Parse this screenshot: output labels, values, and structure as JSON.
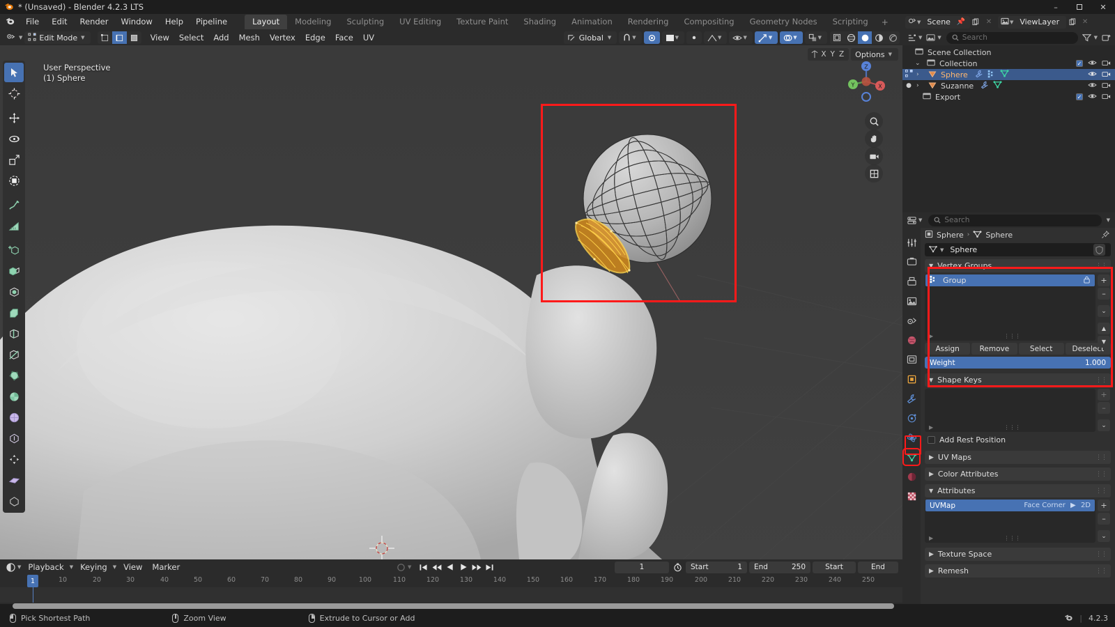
{
  "titlebar": {
    "title": "* (Unsaved) - Blender 4.2.3 LTS",
    "logo_icon": "blender-logo-icon",
    "minimize_label": "–",
    "maximize_label": "❐",
    "close_label": "✕"
  },
  "menubar": {
    "app_icon": "blender-menu-icon",
    "items": [
      "File",
      "Edit",
      "Render",
      "Window",
      "Help",
      "Pipeline"
    ],
    "workspaces": [
      {
        "label": "Layout",
        "active": true
      },
      {
        "label": "Modeling",
        "active": false
      },
      {
        "label": "Sculpting",
        "active": false
      },
      {
        "label": "UV Editing",
        "active": false
      },
      {
        "label": "Texture Paint",
        "active": false
      },
      {
        "label": "Shading",
        "active": false
      },
      {
        "label": "Animation",
        "active": false
      },
      {
        "label": "Rendering",
        "active": false
      },
      {
        "label": "Compositing",
        "active": false
      },
      {
        "label": "Geometry Nodes",
        "active": false
      },
      {
        "label": "Scripting",
        "active": false
      }
    ],
    "add_workspace_label": "+"
  },
  "viewport_header": {
    "editor_type_icon": "editor-type-icon",
    "mode": "Edit Mode",
    "select_modes": [
      {
        "name": "vertex-select-mode",
        "active": false
      },
      {
        "name": "edge-select-mode",
        "active": true
      },
      {
        "name": "face-select-mode",
        "active": false
      }
    ],
    "menus": [
      "View",
      "Select",
      "Add",
      "Mesh",
      "Vertex",
      "Edge",
      "Face",
      "UV"
    ],
    "transform_orientation": "Global",
    "snap_icon": "magnet-icon",
    "proportional_icon": "proportional-editing-icon",
    "visibility_icon": "visibility-icon",
    "gizmo_icon": "gizmo-icon",
    "overlays_icon": "overlays-icon",
    "xray_icon": "xray-icon",
    "shading_modes": [
      "wireframe",
      "solid",
      "material-preview",
      "rendered"
    ],
    "active_shading": "solid"
  },
  "viewport": {
    "perspective_label": "User Perspective",
    "object_label": "(1) Sphere",
    "options_label": "Options",
    "axis_labels": [
      "X",
      "Y",
      "Z"
    ],
    "gizmo_axes": [
      "X",
      "Y",
      "Z"
    ],
    "tools": [
      {
        "name": "tweak-tool",
        "active": true
      },
      {
        "name": "select-box-tool",
        "active": false
      },
      {
        "name": "cursor-tool",
        "active": false
      },
      {
        "name": "move-tool",
        "active": false
      },
      {
        "name": "rotate-tool",
        "active": false
      },
      {
        "name": "scale-tool",
        "active": false
      },
      {
        "name": "transform-tool",
        "active": false
      },
      {
        "name": "annotate-tool",
        "active": false
      },
      {
        "name": "measure-tool",
        "active": false
      },
      {
        "name": "add-cube-tool",
        "active": false
      },
      {
        "name": "extrude-region-tool",
        "active": false
      },
      {
        "name": "inset-faces-tool",
        "active": false
      },
      {
        "name": "bevel-tool",
        "active": false
      },
      {
        "name": "loop-cut-tool",
        "active": false
      },
      {
        "name": "knife-tool",
        "active": false
      },
      {
        "name": "poly-build-tool",
        "active": false
      },
      {
        "name": "spin-tool",
        "active": false
      },
      {
        "name": "smooth-tool",
        "active": false
      },
      {
        "name": "shrink-fatten-tool",
        "active": false
      },
      {
        "name": "shear-tool",
        "active": false
      },
      {
        "name": "rip-region-tool",
        "active": false
      }
    ],
    "nav_buttons": [
      "zoom-icon",
      "pan-icon",
      "camera-icon",
      "ortho-toggle-icon"
    ]
  },
  "scene_bar": {
    "scene_icon": "scene-icon",
    "scene_name": "Scene",
    "view_layer_icon": "viewlayer-icon",
    "view_layer_name": "ViewLayer",
    "pin_icon": "pin-icon",
    "copy_icon": "new-scene-icon",
    "close_icon": "remove-icon"
  },
  "outliner": {
    "display_mode_icon": "outliner-display-icon",
    "filter_icon": "filter-icon",
    "new_collection_icon": "new-collection-icon",
    "search_placeholder": "Search",
    "search_icon": "search-icon",
    "rows": [
      {
        "label": "Scene Collection",
        "icon": "collection-icon",
        "depth": 0,
        "selected": false,
        "expand": "",
        "checkbox": false,
        "eye": false,
        "camera": false
      },
      {
        "label": "Collection",
        "icon": "collection-icon",
        "depth": 1,
        "selected": false,
        "expand": "⌄",
        "checkbox": true,
        "eye": true,
        "camera": true
      },
      {
        "label": "Sphere",
        "icon": "mesh-object-icon",
        "depth": 2,
        "selected": true,
        "expand": "›",
        "checkbox": false,
        "eye": true,
        "camera": true,
        "extra_icons": [
          "modifier-icon",
          "vertex-group-icon",
          "mesh-data-icon"
        ]
      },
      {
        "label": "Suzanne",
        "icon": "mesh-object-icon",
        "depth": 2,
        "selected": false,
        "expand": "›",
        "checkbox": false,
        "eye": true,
        "camera": true,
        "extra_icons": [
          "modifier-icon",
          "mesh-data-icon"
        ]
      },
      {
        "label": "Export",
        "icon": "collection-icon",
        "depth": 1,
        "selected": false,
        "expand": "",
        "checkbox": true,
        "eye": true,
        "camera": true
      }
    ]
  },
  "properties": {
    "editor_icon": "properties-editor-icon",
    "search_placeholder": "Search",
    "search_icon": "search-icon",
    "breadcrumb": {
      "object_icon": "object-icon",
      "object_name": "Sphere",
      "separator": "›",
      "data_icon": "mesh-data-icon",
      "data_name": "Sphere"
    },
    "pin_icon": "pin-icon",
    "datablock": {
      "icon": "mesh-data-icon",
      "name": "Sphere",
      "shield_icon": "fake-user-icon"
    },
    "tabs": [
      {
        "name": "tool-tab",
        "icon": "tool-icon",
        "active": false
      },
      {
        "name": "render-tab",
        "icon": "render-icon",
        "active": false
      },
      {
        "name": "output-tab",
        "icon": "output-icon",
        "active": false
      },
      {
        "name": "view-layer-tab",
        "icon": "view-layer-icon",
        "active": false
      },
      {
        "name": "scene-tab",
        "icon": "scene-props-icon",
        "active": false
      },
      {
        "name": "world-tab",
        "icon": "world-icon",
        "active": false
      },
      {
        "name": "collection-tab",
        "icon": "collection-props-icon",
        "active": false
      },
      {
        "name": "object-tab",
        "icon": "object-props-icon",
        "active": false
      },
      {
        "name": "modifier-tab",
        "icon": "wrench-icon",
        "active": false
      },
      {
        "name": "particles-tab",
        "icon": "particles-icon",
        "active": false
      },
      {
        "name": "physics-tab",
        "icon": "physics-icon",
        "active": false
      },
      {
        "name": "constraints-tab",
        "icon": "constraints-icon",
        "active": false
      },
      {
        "name": "data-tab",
        "icon": "mesh-data-icon",
        "active": true
      },
      {
        "name": "material-tab",
        "icon": "material-icon",
        "active": false
      },
      {
        "name": "texture-tab",
        "icon": "texture-icon",
        "active": false
      }
    ],
    "panels": {
      "vertex_groups": {
        "title": "Vertex Groups",
        "expanded": true,
        "items": [
          {
            "label": "Group",
            "selected": true,
            "icon": "vertex-group-icon",
            "lock_icon": "lock-icon"
          }
        ],
        "side_buttons": [
          "+",
          "–",
          "⌄",
          "▲",
          "▼"
        ],
        "buttons": [
          "Assign",
          "Remove",
          "Select",
          "Deselect"
        ],
        "weight_label": "Weight",
        "weight_value": "1.000"
      },
      "shape_keys": {
        "title": "Shape Keys",
        "expanded": true,
        "items": [],
        "side_buttons": [
          "+",
          "–",
          "⌄"
        ],
        "add_rest_position_label": "Add Rest Position",
        "add_rest_position_checked": false
      },
      "uv_maps": {
        "title": "UV Maps",
        "expanded": false
      },
      "color_attributes": {
        "title": "Color Attributes",
        "expanded": false
      },
      "attributes": {
        "title": "Attributes",
        "expanded": true,
        "items": [
          {
            "label": "UVMap",
            "domain": "Face Corner",
            "type": "2D",
            "selected": true
          }
        ],
        "side_buttons": [
          "+",
          "–",
          "⌄"
        ]
      },
      "texture_space": {
        "title": "Texture Space",
        "expanded": false
      },
      "remesh": {
        "title": "Remesh",
        "expanded": false
      }
    }
  },
  "timeline": {
    "editor_icon": "timeline-editor-icon",
    "menus": [
      "Playback",
      "Keying",
      "View",
      "Marker"
    ],
    "auto_key_icon": "record-icon",
    "playback_buttons": [
      "jump-start-icon",
      "prev-keyframe-icon",
      "play-reverse-icon",
      "play-icon",
      "next-keyframe-icon",
      "jump-end-icon"
    ],
    "current_frame": "1",
    "timer_icon": "use-preview-range-icon",
    "start_label": "Start",
    "start_value": "1",
    "end_label": "End",
    "end_value": "250",
    "marker_start_label": "Start",
    "marker_end_label": "End",
    "ruler_ticks": [
      "10",
      "20",
      "30",
      "40",
      "50",
      "60",
      "70",
      "80",
      "90",
      "100",
      "110",
      "120",
      "130",
      "140",
      "150",
      "160",
      "170",
      "180",
      "190",
      "200",
      "210",
      "220",
      "230",
      "240",
      "250"
    ],
    "playhead_frame": "1"
  },
  "statusbar": {
    "hints": [
      {
        "mouse": "left",
        "label": "Pick Shortest Path"
      },
      {
        "mouse": "middle",
        "label": "Zoom View"
      },
      {
        "mouse": "right",
        "label": "Extrude to Cursor or Add"
      }
    ],
    "version": "4.2.3",
    "scene_stats_icon": "blender-status-icon",
    "separator": "|"
  },
  "colors": {
    "accent_blue": "#4772b3",
    "highlight_red": "#ff1a1a",
    "orange": "#e87d0d",
    "panel_bg": "#303030",
    "editor_bg": "#2b2b2b"
  }
}
